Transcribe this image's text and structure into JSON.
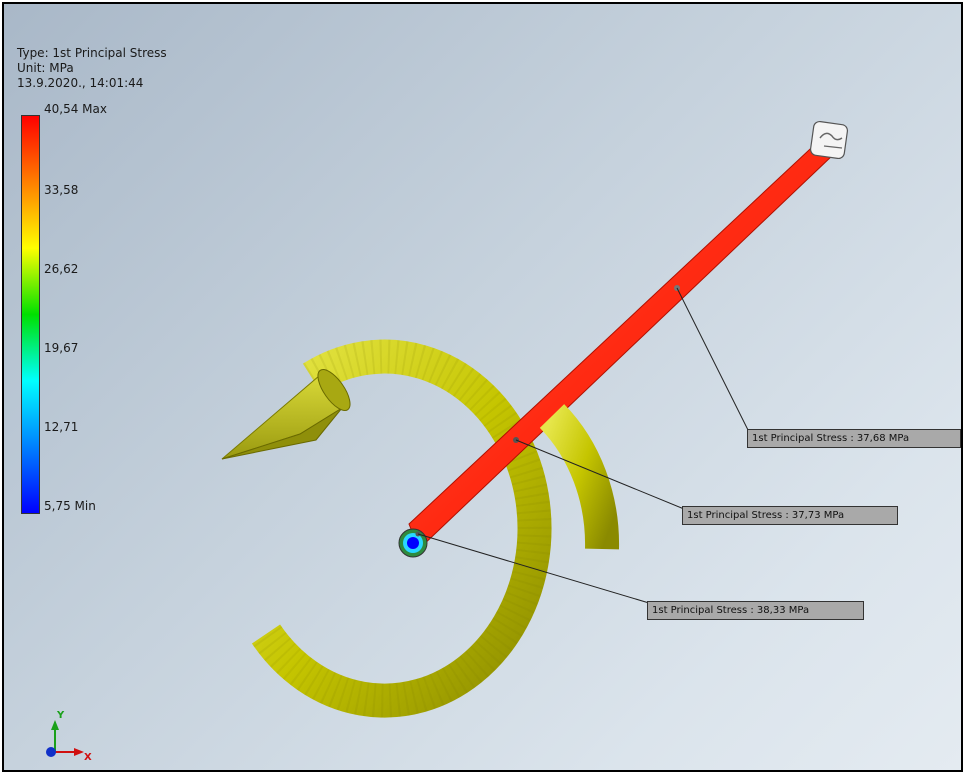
{
  "legend": {
    "type_text": "Type: 1st Principal Stress",
    "unit_text": "Unit: MPa",
    "timestamp": "13.9.2020., 14:01:44",
    "ticks": [
      "40,54 Max",
      "33,58",
      "26,62",
      "19,67",
      "12,71",
      "5,75 Min"
    ]
  },
  "probes": [
    {
      "label": "1st Principal Stress : 37,68 MPa"
    },
    {
      "label": "1st Principal Stress : 37,73 MPa"
    },
    {
      "label": "1st Principal Stress : 38,33 MPa"
    }
  ],
  "axis": {
    "y": "Y",
    "x": "X"
  },
  "colors": {
    "beam": "#ff2a12",
    "moment_arrow": "#c2c200",
    "background_top": "#a9b8c8",
    "background_bottom": "#e4ebf1"
  }
}
